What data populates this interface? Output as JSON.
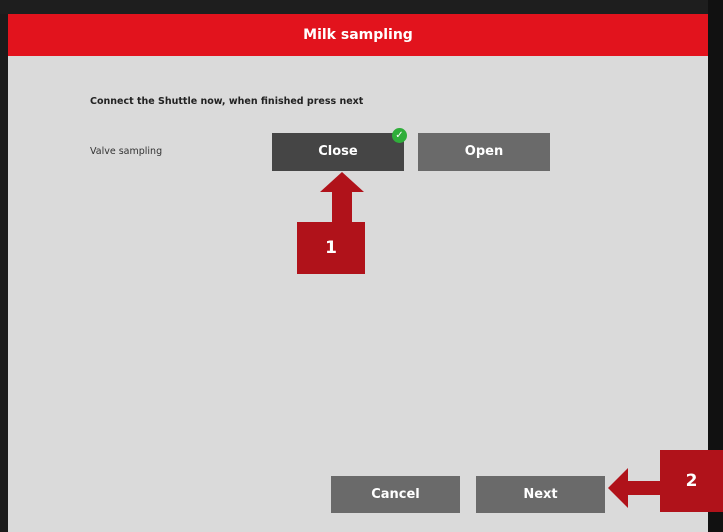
{
  "window": {
    "title": "Milk sampling"
  },
  "instruction": "Connect the Shuttle now, when finished press next",
  "valve": {
    "label": "Valve sampling",
    "options": [
      "Close",
      "Open"
    ],
    "selected": "Close"
  },
  "footer": {
    "cancel_label": "Cancel",
    "next_label": "Next"
  },
  "annotations": [
    {
      "number": "1",
      "target": "Close"
    },
    {
      "number": "2",
      "target": "Next"
    }
  ],
  "colors": {
    "title_bar": "#e2131d",
    "button": "#6a6a6a",
    "button_selected": "#454545",
    "annotation": "#b0121a",
    "check": "#2fae3a"
  },
  "icons": {
    "selected_indicator": "check-icon"
  }
}
